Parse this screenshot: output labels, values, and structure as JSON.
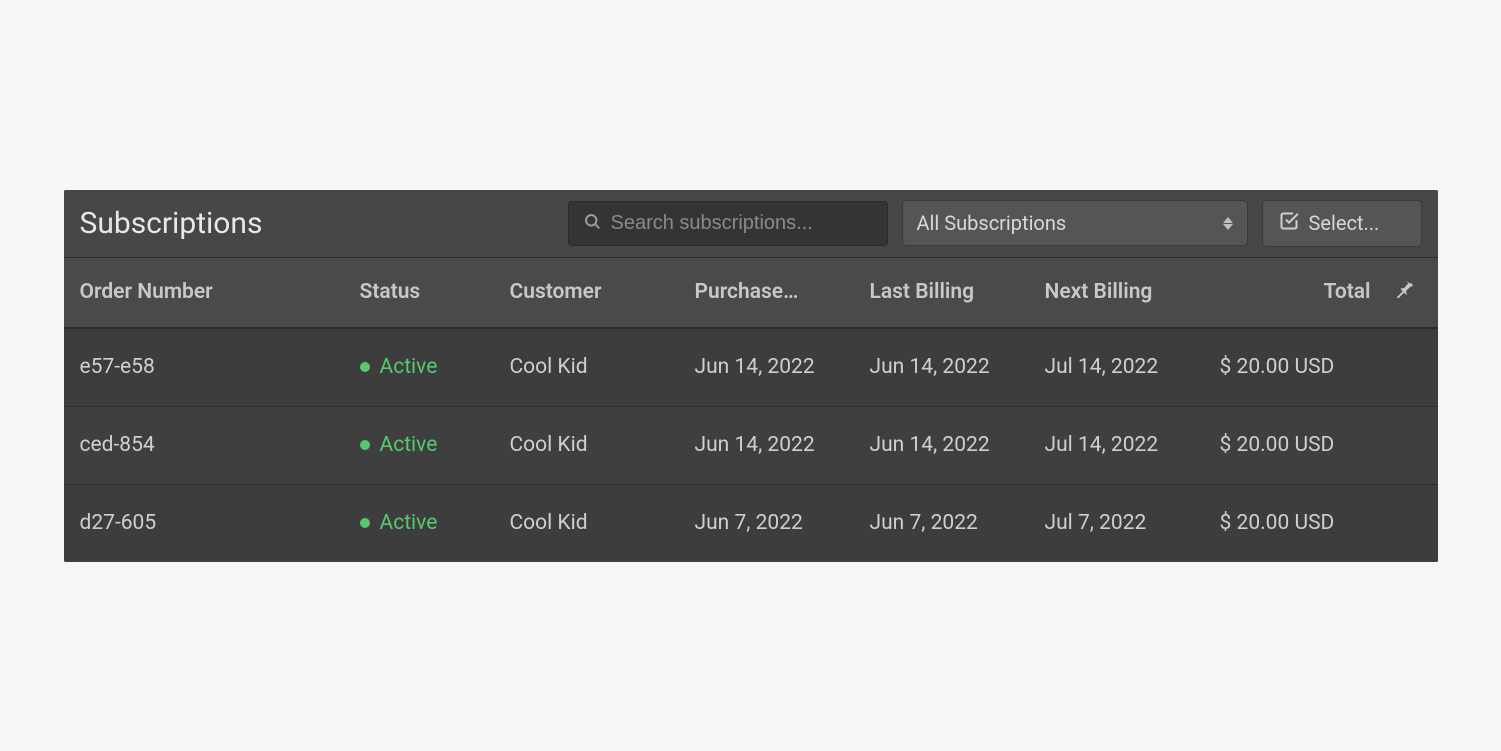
{
  "header": {
    "title": "Subscriptions",
    "search_placeholder": "Search subscriptions...",
    "filter_selected": "All Subscriptions",
    "select_button": "Select..."
  },
  "columns": {
    "order": "Order Number",
    "status": "Status",
    "customer": "Customer",
    "purchase": "Purchase…",
    "last_billing": "Last Billing",
    "next_billing": "Next Billing",
    "total": "Total"
  },
  "rows": [
    {
      "order": "e57-e58",
      "status": "Active",
      "customer": "Cool Kid",
      "purchase": "Jun 14, 2022",
      "last_billing": "Jun 14, 2022",
      "next_billing": "Jul 14, 2022",
      "total": "$ 20.00 USD"
    },
    {
      "order": "ced-854",
      "status": "Active",
      "customer": "Cool Kid",
      "purchase": "Jun 14, 2022",
      "last_billing": "Jun 14, 2022",
      "next_billing": "Jul 14, 2022",
      "total": "$ 20.00 USD"
    },
    {
      "order": "d27-605",
      "status": "Active",
      "customer": "Cool Kid",
      "purchase": "Jun 7, 2022",
      "last_billing": "Jun 7, 2022",
      "next_billing": "Jul 7, 2022",
      "total": "$ 20.00 USD"
    }
  ],
  "colors": {
    "status_active": "#55c96e"
  }
}
